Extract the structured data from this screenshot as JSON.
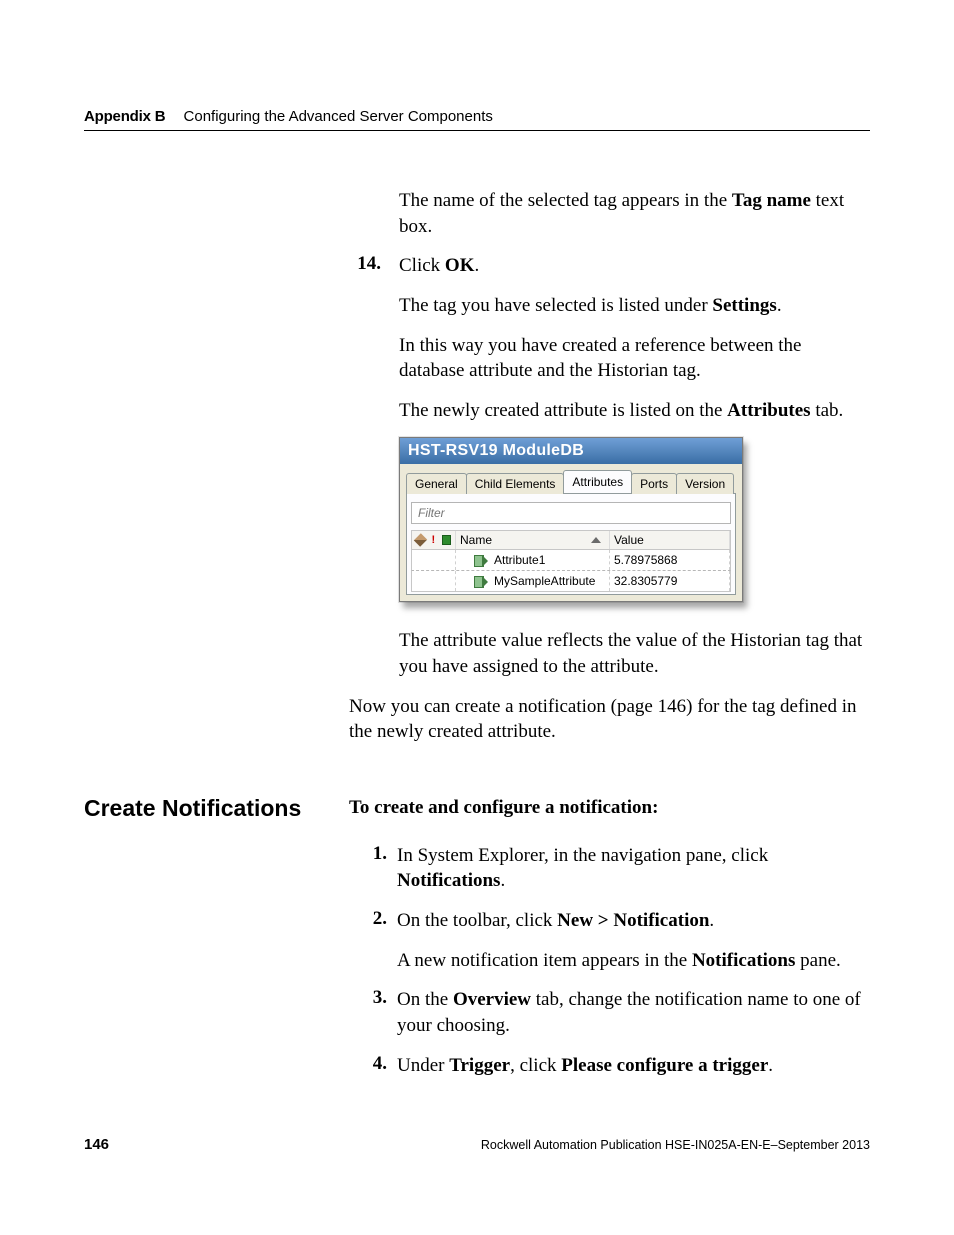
{
  "header": {
    "appendix_label": "Appendix B",
    "section_title": "Configuring the Advanced Server Components"
  },
  "body": {
    "p1_pre": "The name of the selected tag appears in the ",
    "p1_b": "Tag name",
    "p1_post": " text box.",
    "step14_num": "14.",
    "step14_pre": "Click ",
    "step14_b": "OK",
    "step14_post": ".",
    "p3_pre": "The tag you have selected is listed under ",
    "p3_b": "Settings",
    "p3_post": ".",
    "p4": "In this way you have created a reference between the database attribute and the Historian tag.",
    "p5_pre": "The newly created attribute is listed on the ",
    "p5_b": "Attributes",
    "p5_post": " tab.",
    "p6": "The attribute value reflects the value of the Historian tag that you have assigned to the attribute.",
    "p7": "Now you can create a notification (page 146) for the tag defined in the newly created attribute."
  },
  "figure": {
    "title": "HST-RSV19 ModuleDB",
    "tabs": {
      "general": "General",
      "child": "Child Elements",
      "attributes": "Attributes",
      "ports": "Ports",
      "version": "Version"
    },
    "filter_placeholder": "Filter",
    "col_name": "Name",
    "col_value": "Value",
    "rows": [
      {
        "name": "Attribute1",
        "value": "5.78975868"
      },
      {
        "name": "MySampleAttribute",
        "value": "32.8305779"
      }
    ]
  },
  "section2": {
    "heading": "Create Notifications",
    "lead": "To create and configure a notification:",
    "items": [
      {
        "n": "1.",
        "pre": "In System Explorer, in the navigation pane, click ",
        "b": "Notifications",
        "post": "."
      },
      {
        "n": "2.",
        "pre": "On the toolbar, click ",
        "b": "New > Notification",
        "post": ".",
        "sub_pre": "A new notification item appears in the ",
        "sub_b": "Notifications",
        "sub_post": " pane."
      },
      {
        "n": "3.",
        "pre": "On the ",
        "b": "Overview",
        "post": " tab, change the notification name to one of your choosing."
      },
      {
        "n": "4.",
        "pre": "Under ",
        "b": "Trigger",
        "mid": ", click ",
        "b2": "Please configure a trigger",
        "post": "."
      }
    ]
  },
  "footer": {
    "page": "146",
    "pub": "Rockwell Automation Publication HSE-IN025A-EN-E–September 2013"
  }
}
